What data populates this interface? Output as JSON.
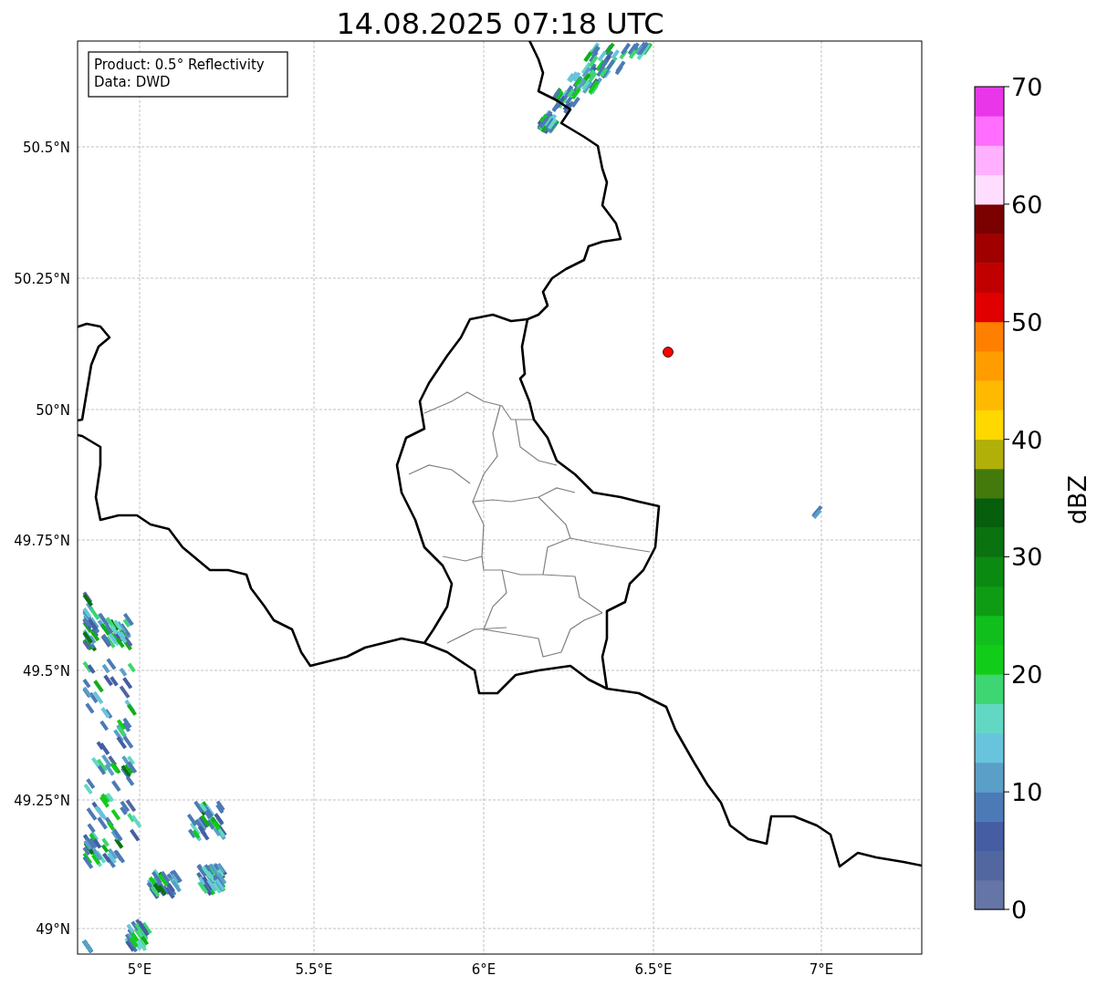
{
  "title": "14.08.2025 07:18 UTC",
  "info_box": {
    "lines": [
      "Product: 0.5° Reflectivity",
      "Data: DWD"
    ]
  },
  "map": {
    "lat_ticks": [
      "50.5°N",
      "50.25°N",
      "50°N",
      "49.75°N",
      "49.5°N",
      "49.25°N",
      "49°N"
    ],
    "lon_ticks": [
      "5°E",
      "5.5°E",
      "6°E",
      "6.5°E",
      "7°E"
    ]
  },
  "colorbar": {
    "label": "dBZ",
    "ticks": [
      "70",
      "60",
      "50",
      "40",
      "30",
      "20",
      "10",
      "0"
    ],
    "bins": [
      {
        "color": "#6475a6"
      },
      {
        "color": "#5267a0"
      },
      {
        "color": "#455ea3"
      },
      {
        "color": "#4c7ab6"
      },
      {
        "color": "#5a9fc8"
      },
      {
        "color": "#67c4dc"
      },
      {
        "color": "#62d8c4"
      },
      {
        "color": "#3dd672"
      },
      {
        "color": "#12cc1a"
      },
      {
        "color": "#11bf1c"
      },
      {
        "color": "#0e9c14"
      },
      {
        "color": "#0b8a12"
      },
      {
        "color": "#0a720f"
      },
      {
        "color": "#075e0c"
      },
      {
        "color": "#447a0c"
      },
      {
        "color": "#b0b008"
      },
      {
        "color": "#ffd800"
      },
      {
        "color": "#ffb900"
      },
      {
        "color": "#ff9d00"
      },
      {
        "color": "#ff7f00"
      },
      {
        "color": "#e00000"
      },
      {
        "color": "#c00000"
      },
      {
        "color": "#a00000"
      },
      {
        "color": "#7b0000"
      },
      {
        "color": "#ffddff"
      },
      {
        "color": "#ffb0ff"
      },
      {
        "color": "#ff6eff"
      },
      {
        "color": "#e936e9"
      }
    ]
  }
}
